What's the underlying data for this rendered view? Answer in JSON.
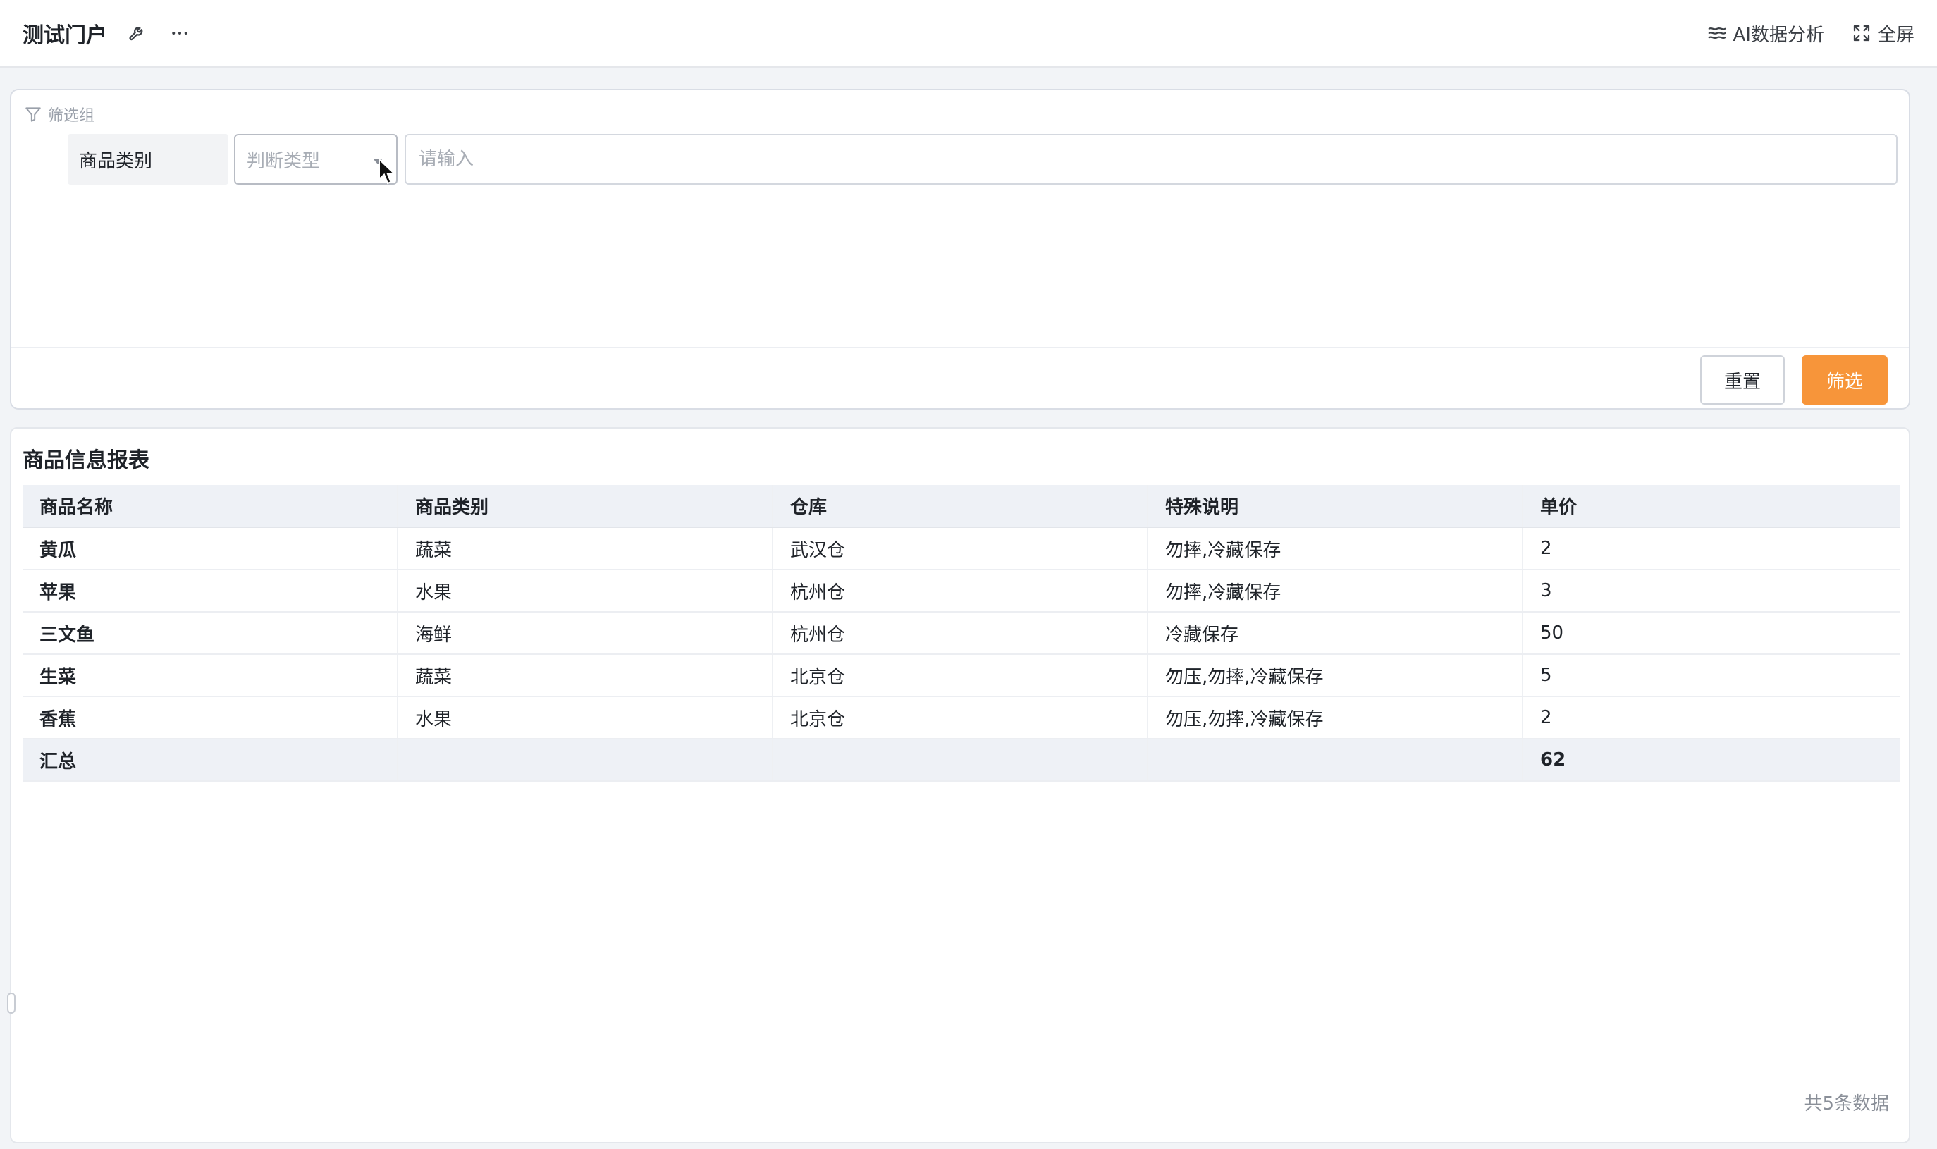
{
  "header": {
    "title": "测试门户",
    "ai_label": "AI数据分析",
    "fullscreen_label": "全屏",
    "icons": [
      "wrench-icon",
      "more-icon",
      "ai-analysis-icon",
      "fullscreen-icon"
    ]
  },
  "filter": {
    "group_label": "筛选组",
    "field_label": "商品类别",
    "select_placeholder": "判断类型",
    "input_placeholder": "请输入",
    "reset_label": "重置",
    "submit_label": "筛选",
    "accent_color": "#f7953a"
  },
  "report": {
    "title": "商品信息报表",
    "columns": [
      "商品名称",
      "商品类别",
      "仓库",
      "特殊说明",
      "单价"
    ],
    "rows": [
      [
        "黄瓜",
        "蔬菜",
        "武汉仓",
        "勿摔,冷藏保存",
        "2"
      ],
      [
        "苹果",
        "水果",
        "杭州仓",
        "勿摔,冷藏保存",
        "3"
      ],
      [
        "三文鱼",
        "海鲜",
        "杭州仓",
        "冷藏保存",
        "50"
      ],
      [
        "生菜",
        "蔬菜",
        "北京仓",
        "勿压,勿摔,冷藏保存",
        "5"
      ],
      [
        "香蕉",
        "水果",
        "北京仓",
        "勿压,勿摔,冷藏保存",
        "2"
      ]
    ],
    "total_label": "汇总",
    "total_value": "62",
    "record_count": "共5条数据"
  }
}
